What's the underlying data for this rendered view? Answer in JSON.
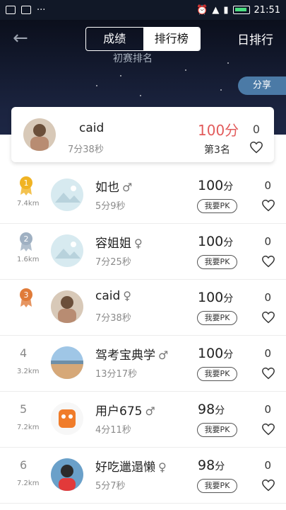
{
  "status": {
    "time": "21:51"
  },
  "header": {
    "tabs": [
      "成绩",
      "排行榜"
    ],
    "active_tab": 1,
    "daily_label": "日排行",
    "share_label": "分享",
    "faint_title": "初赛排名"
  },
  "mine": {
    "name": "caid",
    "time": "7分38秒",
    "score": "100分",
    "rank": "第3名",
    "likes": "0"
  },
  "pk_label": "我要PK",
  "rows": [
    {
      "rank": "1",
      "medal": "gold",
      "dist": "7.4km",
      "name": "如也",
      "gender": "male",
      "time": "5分9秒",
      "score": "100",
      "likes": "0"
    },
    {
      "rank": "2",
      "medal": "silver",
      "dist": "1.6km",
      "name": "容姐姐",
      "gender": "female",
      "time": "7分25秒",
      "score": "100",
      "likes": "0"
    },
    {
      "rank": "3",
      "medal": "bronze",
      "dist": "",
      "name": "caid",
      "gender": "female",
      "time": "7分38秒",
      "score": "100",
      "likes": "0"
    },
    {
      "rank": "4",
      "medal": "",
      "dist": "3.2km",
      "name": "驾考宝典学",
      "gender": "male",
      "time": "13分17秒",
      "score": "100",
      "likes": "0"
    },
    {
      "rank": "5",
      "medal": "",
      "dist": "7.2km",
      "name": "用户675",
      "gender": "male",
      "time": "4分11秒",
      "score": "98",
      "likes": "0"
    },
    {
      "rank": "6",
      "medal": "",
      "dist": "7.2km",
      "name": "好吃邋遢懒",
      "gender": "female",
      "time": "5分7秒",
      "score": "98",
      "likes": "0"
    }
  ],
  "score_unit": "分",
  "colors": {
    "header_bg": "#1b2440",
    "accent_red": "#e25b5b",
    "share_bg": "#4b7aa6"
  }
}
